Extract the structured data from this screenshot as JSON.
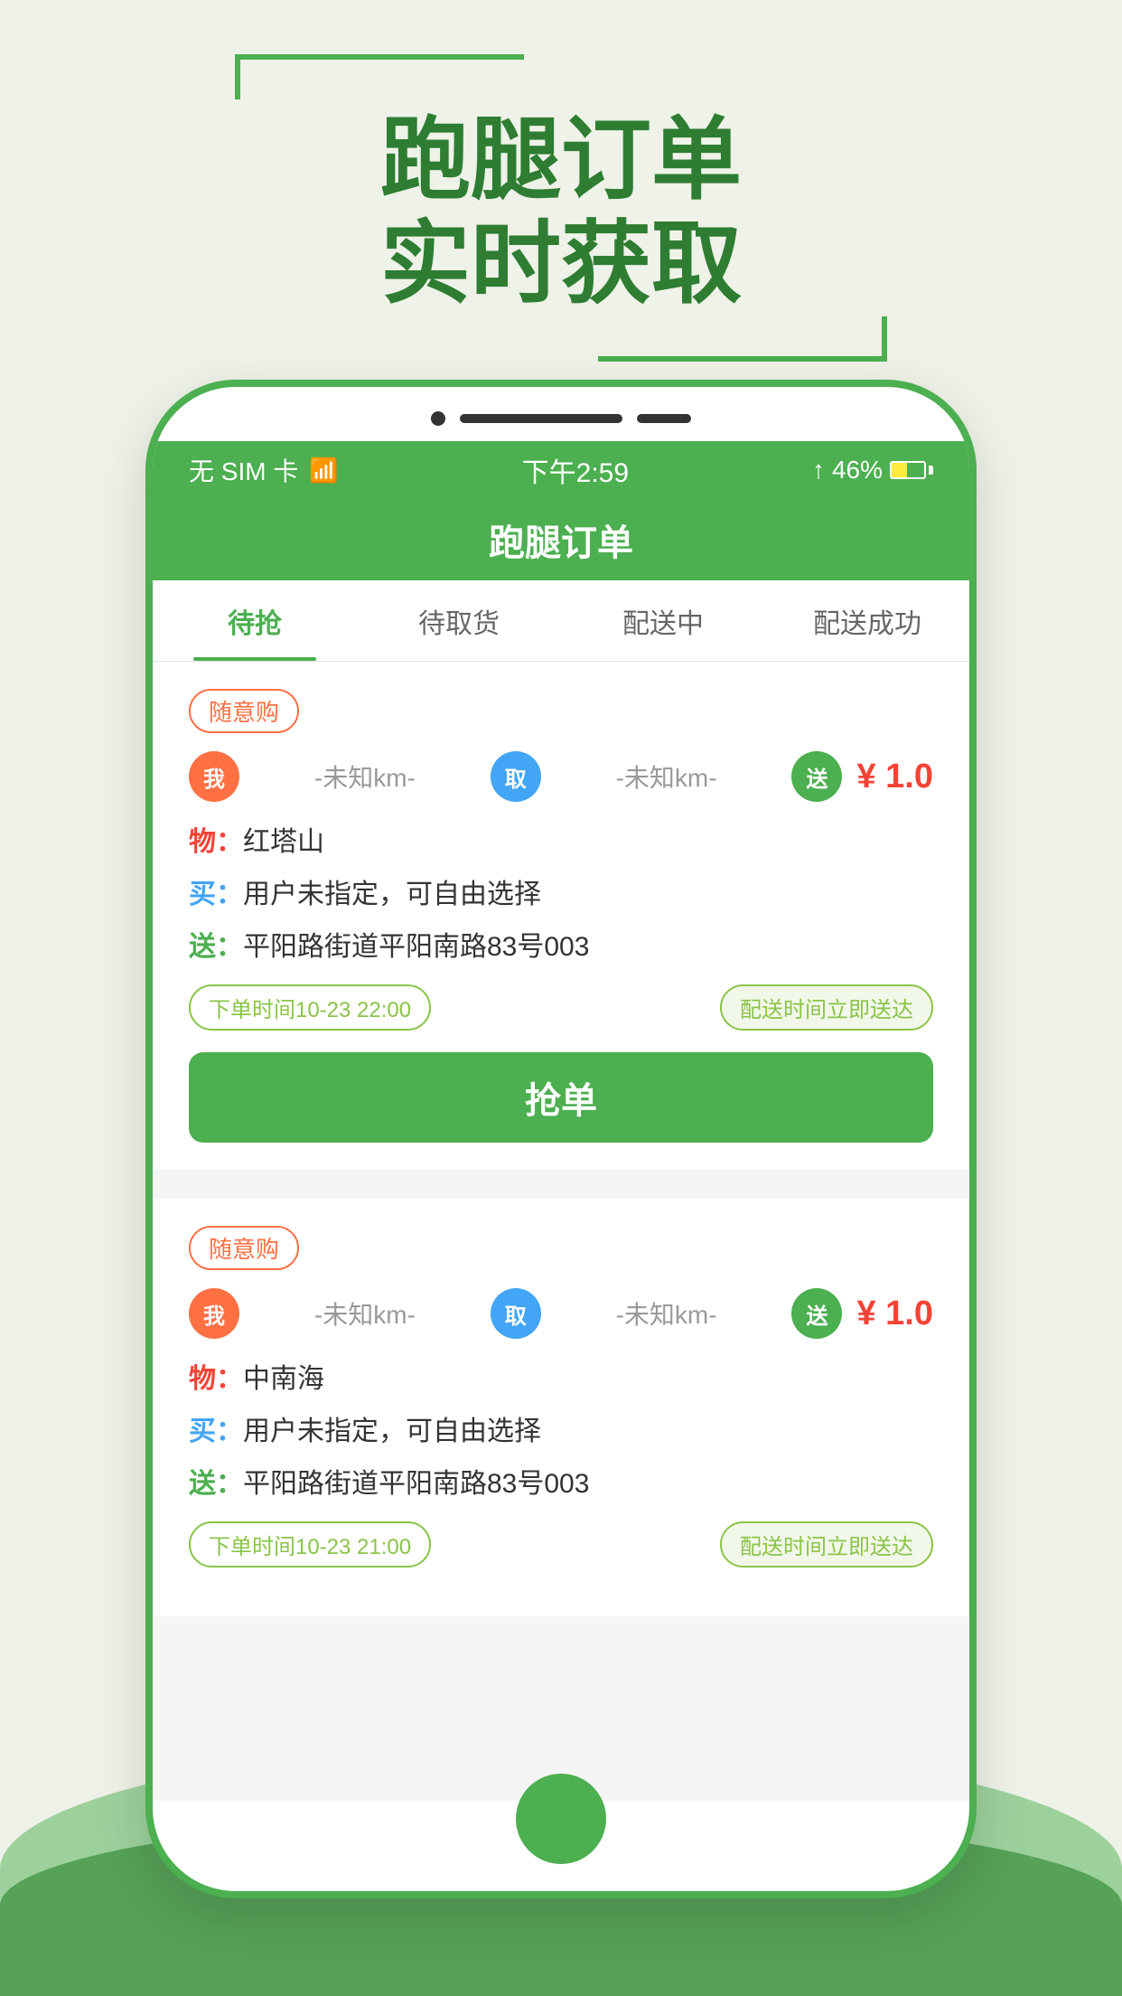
{
  "background": {
    "color": "#eef2e8"
  },
  "top_section": {
    "title_line1": "跑腿订单",
    "title_line2": "实时获取",
    "bracket_color": "#4caf50"
  },
  "status_bar": {
    "carrier": "无 SIM 卡",
    "wifi": "📶",
    "time": "下午2:59",
    "signal_icon": "↑",
    "battery_percent": "46%",
    "battery_color": "#ffeb3b"
  },
  "app_header": {
    "title": "跑腿订单"
  },
  "tabs": [
    {
      "label": "待抢",
      "active": true
    },
    {
      "label": "待取货",
      "active": false
    },
    {
      "label": "配送中",
      "active": false
    },
    {
      "label": "配送成功",
      "active": false
    }
  ],
  "orders": [
    {
      "tag": "随意购",
      "route": {
        "from_icon": "我",
        "from_distance": "-未知km-",
        "pick_icon": "取",
        "pick_distance": "-未知km-",
        "deliver_icon": "送",
        "price": "¥ 1.0"
      },
      "goods": "红塔山",
      "goods_label": "物：",
      "buy_note": "用户未指定，可自由选择",
      "buy_label": "买：",
      "address": "平阳路街道平阳南路83号003",
      "address_label": "送：",
      "order_time": "下单时间10-23 22:00",
      "delivery_time": "配送时间立即送达",
      "grab_btn": "抢单"
    },
    {
      "tag": "随意购",
      "route": {
        "from_icon": "我",
        "from_distance": "-未知km-",
        "pick_icon": "取",
        "pick_distance": "-未知km-",
        "deliver_icon": "送",
        "price": "¥ 1.0"
      },
      "goods": "中南海",
      "goods_label": "物：",
      "buy_note": "用户未指定，可自由选择",
      "buy_label": "买：",
      "address": "平阳路街道平阳南路83号003",
      "address_label": "送：",
      "order_time": "下单时间10-23 21:00",
      "delivery_time": "配送时间立即送达"
    }
  ],
  "bottom_home_btn": "⬤"
}
